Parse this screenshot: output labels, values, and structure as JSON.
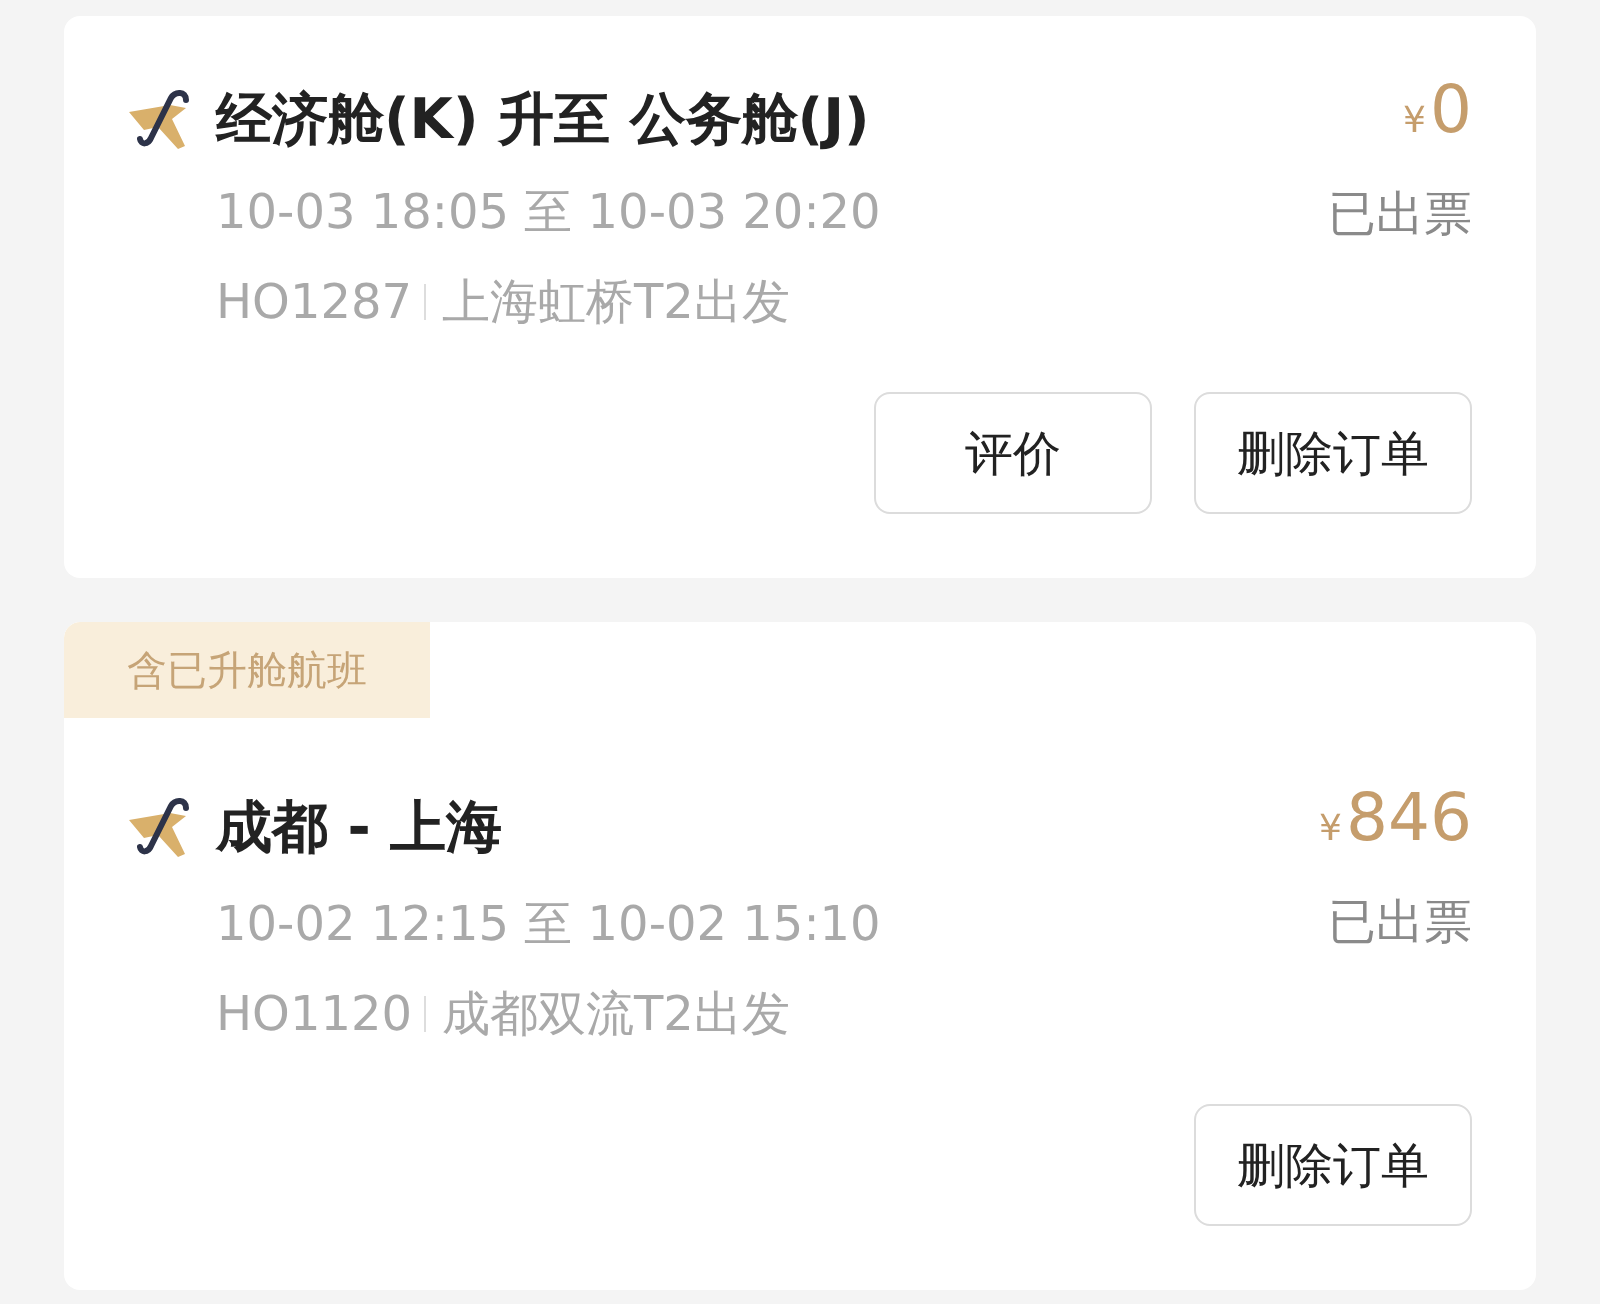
{
  "orders": [
    {
      "title": "经济舱(K) 升至 公务舱(J)",
      "time_range": "10-03 18:05 至 10-03 20:20",
      "flight_no": "HO1287",
      "departure": "上海虹桥T2出发",
      "currency": "¥",
      "amount": "0",
      "status": "已出票",
      "buttons": [
        "评价",
        "删除订单"
      ]
    },
    {
      "tag": "含已升舱航班",
      "title": "成都 - 上海",
      "time_range": "10-02 12:15 至 10-02 15:10",
      "flight_no": "HO1120",
      "departure": "成都双流T2出发",
      "currency": "¥",
      "amount": "846",
      "status": "已出票",
      "buttons": [
        "删除订单"
      ]
    }
  ]
}
